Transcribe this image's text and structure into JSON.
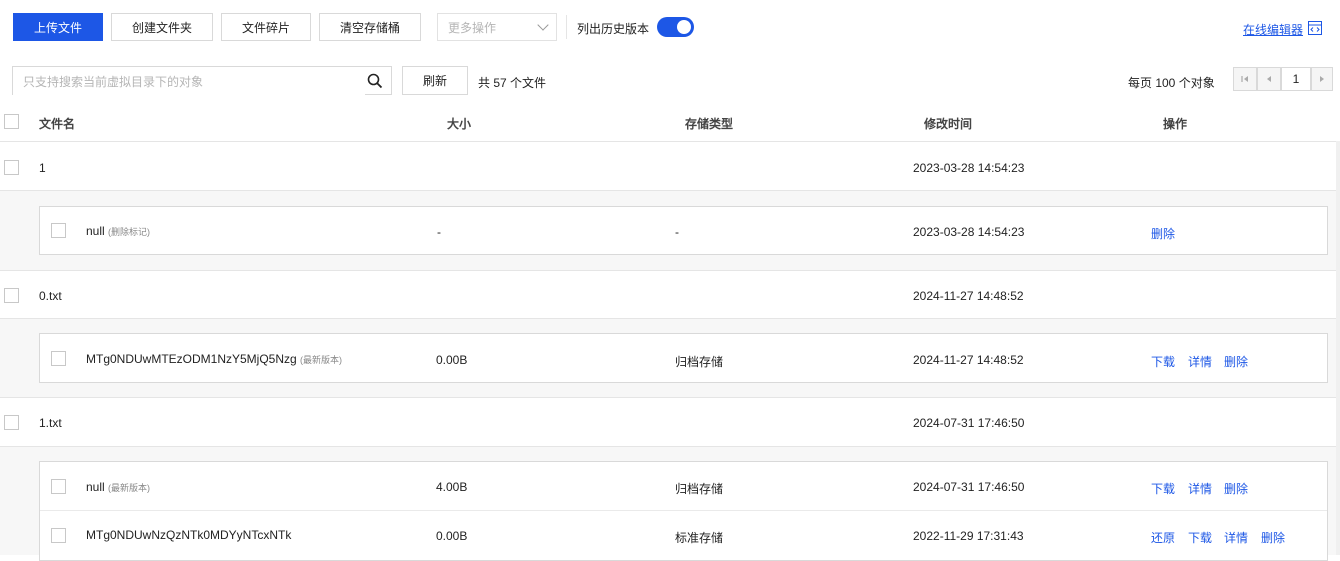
{
  "toolbar": {
    "upload": "上传文件",
    "create_folder": "创建文件夹",
    "fragments": "文件碎片",
    "clear_bucket": "清空存储桶",
    "more_actions": "更多操作",
    "list_history_label": "列出历史版本",
    "list_history_on": true,
    "online_editor": "在线编辑器"
  },
  "search": {
    "placeholder": "只支持搜索当前虚拟目录下的对象",
    "refresh": "刷新",
    "total": "共 57 个文件"
  },
  "pagination": {
    "per_page": "每页 100 个对象",
    "page": "1"
  },
  "columns": {
    "name": "文件名",
    "size": "大小",
    "storage": "存储类型",
    "modified": "修改时间",
    "actions": "操作"
  },
  "colors": {
    "accent": "#1d57e6"
  },
  "rows": [
    {
      "name": "1",
      "modified": "2023-03-28 14:54:23"
    },
    {
      "name": "null",
      "tag": "(删除标记)",
      "size": "-",
      "storage": "-",
      "modified": "2023-03-28 14:54:23",
      "actions": [
        "删除"
      ]
    },
    {
      "name": "0.txt",
      "modified": "2024-11-27 14:48:52"
    },
    {
      "name": "MTg0NDUwMTEzODM1NzY5MjQ5Nzg",
      "tag": "(最新版本)",
      "size": "0.00B",
      "storage": "归档存储",
      "modified": "2024-11-27 14:48:52",
      "actions": [
        "下载",
        "详情",
        "删除"
      ]
    },
    {
      "name": "1.txt",
      "modified": "2024-07-31 17:46:50"
    },
    {
      "name": "null",
      "tag": "(最新版本)",
      "size": "4.00B",
      "storage": "归档存储",
      "modified": "2024-07-31 17:46:50",
      "actions": [
        "下载",
        "详情",
        "删除"
      ]
    },
    {
      "name": "MTg0NDUwNzQzNTk0MDYyNTcxNTk",
      "size": "0.00B",
      "storage": "标准存储",
      "modified": "2022-11-29 17:31:43",
      "actions": [
        "还原",
        "下载",
        "详情",
        "删除"
      ]
    }
  ]
}
